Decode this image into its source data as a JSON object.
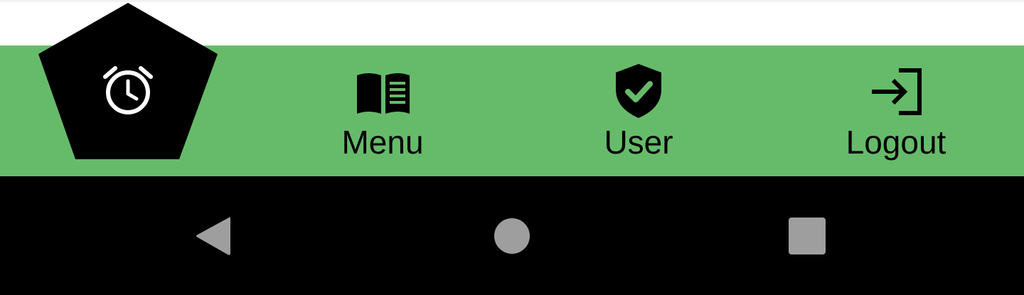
{
  "colors": {
    "nav_background": "#66bb6a",
    "active_background": "#000000",
    "active_icon": "#ffffff",
    "icon": "#000000",
    "system_bar": "#000000",
    "system_buttons": "#9e9e9e"
  },
  "bottom_nav": {
    "active_item": {
      "icon": "alarm-clock-icon"
    },
    "items": [
      {
        "label": "Menu",
        "icon": "open-book-icon"
      },
      {
        "label": "User",
        "icon": "verified-shield-icon"
      },
      {
        "label": "Logout",
        "icon": "login-arrow-icon"
      }
    ]
  },
  "system_nav": {
    "buttons": [
      {
        "icon": "back-triangle-icon"
      },
      {
        "icon": "home-circle-icon"
      },
      {
        "icon": "recents-square-icon"
      }
    ]
  }
}
